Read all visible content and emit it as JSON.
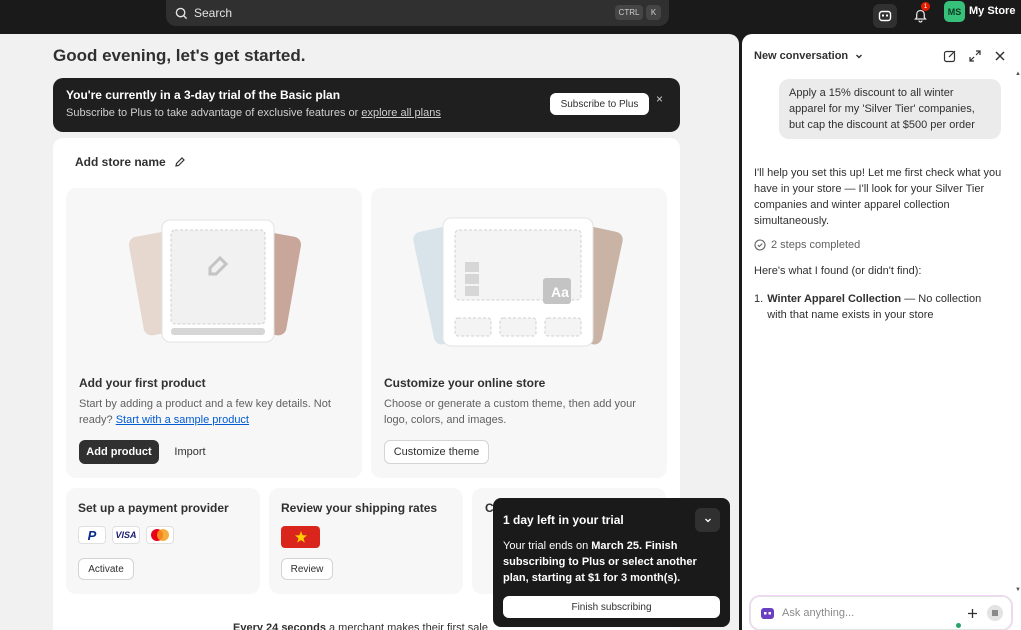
{
  "topbar": {
    "search_placeholder": "Search",
    "shortcut_ctrl": "CTRL",
    "shortcut_key": "K",
    "notification_count": "1",
    "avatar_initials": "MS",
    "store_name": "My Store"
  },
  "main": {
    "greeting": "Good evening, let's get started.",
    "trial_banner": {
      "title": "You're currently in a 3-day trial of the Basic plan",
      "subtitle_prefix": "Subscribe to Plus to take advantage of exclusive features or ",
      "subtitle_link": "explore all plans",
      "button": "Subscribe to Plus",
      "close": "×"
    },
    "setup": {
      "store_name_label": "Add store name",
      "product_card": {
        "title": "Add your first product",
        "desc_prefix": "Start by adding a product and a few key details. Not ready? ",
        "desc_link": "Start with a sample product",
        "primary_button": "Add product",
        "secondary_button": "Import"
      },
      "store_card": {
        "title": "Customize your online store",
        "desc": "Choose or generate a custom theme, then add your logo, colors, and images.",
        "button": "Customize theme",
        "preview_text": "Aa"
      },
      "payment_card": {
        "title": "Set up a payment provider",
        "logos": [
          "P",
          "VISA",
          "MC"
        ],
        "button": "Activate"
      },
      "shipping_card": {
        "title": "Review your shipping rates",
        "flag_icon": "vietnam-flag",
        "button": "Review"
      },
      "third_card_initial": "C",
      "footnote_bold": "Every 24 seconds",
      "footnote_rest": " a merchant makes their first sale"
    }
  },
  "toast": {
    "title": "1 day left in your trial",
    "body_prefix": "Your trial ends on ",
    "body_date": "March 25",
    "body_rest": ". Finish subscribing to Plus or select another plan, starting at $1 for 3 month(s).",
    "button": "Finish subscribing"
  },
  "assistant": {
    "title": "New conversation",
    "user_message": "Apply a 15% discount to all winter apparel for my 'Silver Tier' companies, but cap the discount at $500 per order",
    "response_1": "I'll help you set this up! Let me first check what you have in your store — I'll look for your Silver Tier companies and winter apparel collection simultaneously.",
    "steps": "2 steps completed",
    "response_2": "Here's what I found (or didn't find):",
    "finding_number": "1.",
    "finding_bold": "Winter Apparel Collection",
    "finding_rest": " — No collection with that name exists in your store",
    "input_placeholder": "Ask anything..."
  }
}
